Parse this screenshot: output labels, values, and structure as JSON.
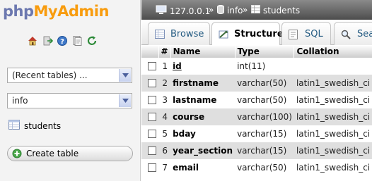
{
  "nav": {
    "logo": {
      "part1": "php",
      "part2": "My",
      "part3": "Admin"
    },
    "icons": [
      "home-icon",
      "logout-icon",
      "help-icon",
      "docs-icon",
      "reload-icon"
    ],
    "recent_tables": "(Recent tables) ...",
    "database": "info",
    "table_name": "students",
    "create_table_label": "Create table"
  },
  "breadcrumb": {
    "server": "127.0.0.1",
    "database": "info",
    "table": "students",
    "sep": "»"
  },
  "tabs": [
    {
      "label": "Browse",
      "icon": "browse-icon",
      "active": false
    },
    {
      "label": "Structure",
      "icon": "structure-icon",
      "active": true
    },
    {
      "label": "SQL",
      "icon": "sql-icon",
      "active": false
    },
    {
      "label": "Sea",
      "icon": "search-icon",
      "active": false
    }
  ],
  "columns": {
    "num": "#",
    "name": "Name",
    "type": "Type",
    "collation": "Collation"
  },
  "rows": [
    {
      "num": "1",
      "name": "id",
      "type": "int(11)",
      "collation": "",
      "primary": true
    },
    {
      "num": "2",
      "name": "firstname",
      "type": "varchar(50)",
      "collation": "latin1_swedish_ci",
      "primary": false
    },
    {
      "num": "3",
      "name": "lastname",
      "type": "varchar(50)",
      "collation": "latin1_swedish_ci",
      "primary": false
    },
    {
      "num": "4",
      "name": "course",
      "type": "varchar(100)",
      "collation": "latin1_swedish_ci",
      "primary": false
    },
    {
      "num": "5",
      "name": "bday",
      "type": "varchar(15)",
      "collation": "latin1_swedish_ci",
      "primary": false
    },
    {
      "num": "6",
      "name": "year_section",
      "type": "varchar(15)",
      "collation": "latin1_swedish_ci",
      "primary": false
    },
    {
      "num": "7",
      "name": "email",
      "type": "varchar(50)",
      "collation": "latin1_swedish_ci",
      "primary": false
    }
  ],
  "colors": {
    "accent_blue": "#6c78af",
    "accent_orange": "#f89c0e",
    "link": "#235a81"
  }
}
